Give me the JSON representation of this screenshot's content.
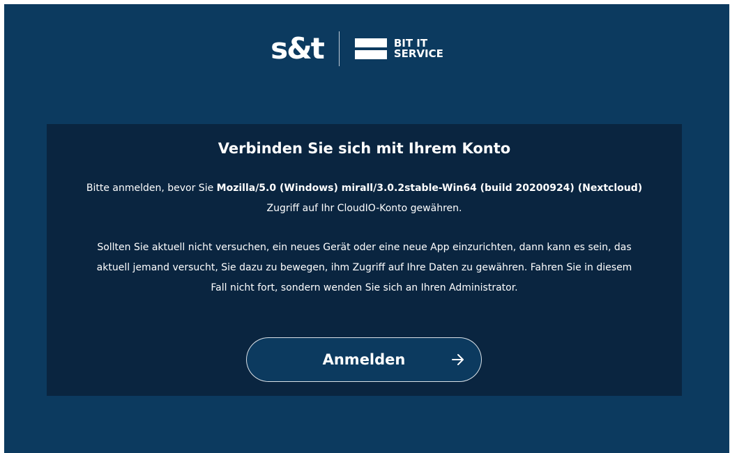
{
  "branding": {
    "logo_primary": "s&t",
    "logo_secondary_line1": "BIT IT",
    "logo_secondary_line2": "SERVICE"
  },
  "card": {
    "title": "Verbinden Sie sich mit Ihrem Konto",
    "intro_prefix": "Bitte anmelden, bevor Sie ",
    "client_name": "Mozilla/5.0 (Windows) mirall/3.0.2stable-Win64 (build 20200924) (Nextcloud)",
    "intro_suffix": "Zugriff auf Ihr CloudIO-Konto gewähren.",
    "warning_line1": "Sollten Sie aktuell nicht versuchen, ein neues Gerät oder eine neue App einzurichten, dann kann es sein, das",
    "warning_line2": "aktuell jemand versucht, Sie dazu zu bewegen, ihm Zugriff auf Ihre Daten zu gewähren. Fahren Sie in diesem",
    "warning_line3": "Fall nicht fort, sondern wenden Sie sich an Ihren Administrator.",
    "login_button_label": "Anmelden",
    "login_button_icon": "arrow-right-icon"
  },
  "colors": {
    "page_background": "#0c3a5f",
    "card_background": "#0a2540",
    "text": "#ffffff"
  }
}
